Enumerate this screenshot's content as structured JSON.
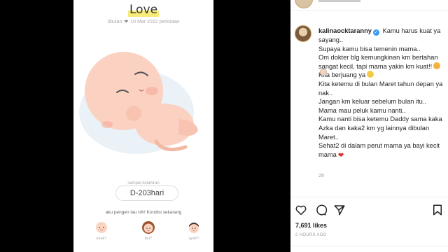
{
  "post_image": {
    "title": "Love",
    "age": "3bulan",
    "due_date": "10 Mar 2022 perkiraan",
    "due_label": "sampai kelahiran",
    "countdown": "D-203hari",
    "question": "aku pengen tau nih! Kondisi sekarang",
    "avatars": [
      {
        "label": "anak?",
        "icon": "baby-face-icon"
      },
      {
        "label": "ibu?",
        "icon": "mother-face-icon"
      },
      {
        "label": "ayah?",
        "icon": "father-face-icon"
      }
    ]
  },
  "instagram": {
    "username": "kalinaocktaranny",
    "caption_lines": [
      "Kamu harus kuat ya sayang..",
      "Supaya kamu bisa temenin mama..",
      "Om dokter blg kemungkinan km bertahan sangat kecil, tapi mama yakin km kuat!!",
      "Kita berjuang ya",
      "Kita ketemu di bulan Maret tahun depan ya nak..",
      "Jangan km keluar sebelum bulan itu..",
      "Mama mau peluk kamu nanti..",
      "Kamu nanti bisa ketemu Daddy sama kaka Azka dan kaka2 km yg lainnya dibulan Maret..",
      "Sehat2 di dalam perut mama ya bayi kecit mama"
    ],
    "time_ago": "2h",
    "likes": "7,691 likes",
    "posted": "2 HOURS AGO",
    "verified_color": "#3897f0"
  }
}
